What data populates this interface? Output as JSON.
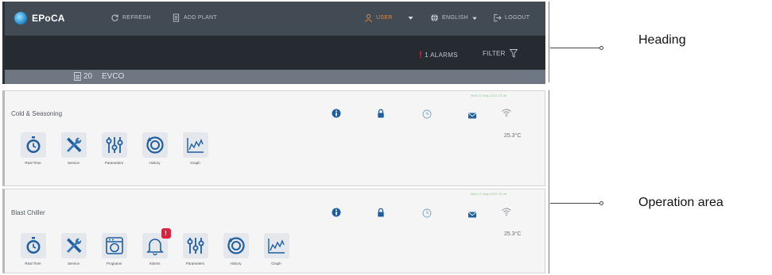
{
  "app": {
    "name": "EPoCA"
  },
  "nav": {
    "refresh": "REFRESH",
    "add_plant": "ADD PLANT",
    "user": "USER",
    "language": "ENGLISH",
    "logout": "LOGOUT"
  },
  "subbar": {
    "alarms": "1 ALARMS",
    "filter": "FILTER"
  },
  "device_bar": {
    "count": "20",
    "name": "EVCO"
  },
  "devices": [
    {
      "name": "Cold & Seasoning",
      "timestamp": "Wed 11 May 2022 12:49",
      "temperature": "25.3°C",
      "tools": [
        {
          "label": "Real Time",
          "icon": "stopwatch-icon"
        },
        {
          "label": "Service",
          "icon": "wrench-screwdriver-icon"
        },
        {
          "label": "Parameters",
          "icon": "sliders-icon"
        },
        {
          "label": "History",
          "icon": "history-icon"
        },
        {
          "label": "Graph",
          "icon": "graph-icon"
        }
      ]
    },
    {
      "name": "Blast Chiller",
      "timestamp": "Wed 11 May 2022 12:49",
      "temperature": "25.3°C",
      "tools": [
        {
          "label": "Real Time",
          "icon": "stopwatch-icon"
        },
        {
          "label": "Service",
          "icon": "wrench-screwdriver-icon"
        },
        {
          "label": "Programs",
          "icon": "oven-icon"
        },
        {
          "label": "Alarms",
          "icon": "bell-icon",
          "badge": "!"
        },
        {
          "label": "Parameters",
          "icon": "sliders-icon"
        },
        {
          "label": "History",
          "icon": "history-icon"
        },
        {
          "label": "Graph",
          "icon": "graph-icon"
        }
      ]
    }
  ],
  "callouts": {
    "heading": "Heading",
    "operation": "Operation area"
  },
  "colors": {
    "topbar": "#424a54",
    "subbar": "#262b31",
    "devbar": "#6e7782",
    "icon_blue": "#1f5fa0",
    "alarm_red": "#e0213d",
    "user_orange": "#e8883a"
  }
}
